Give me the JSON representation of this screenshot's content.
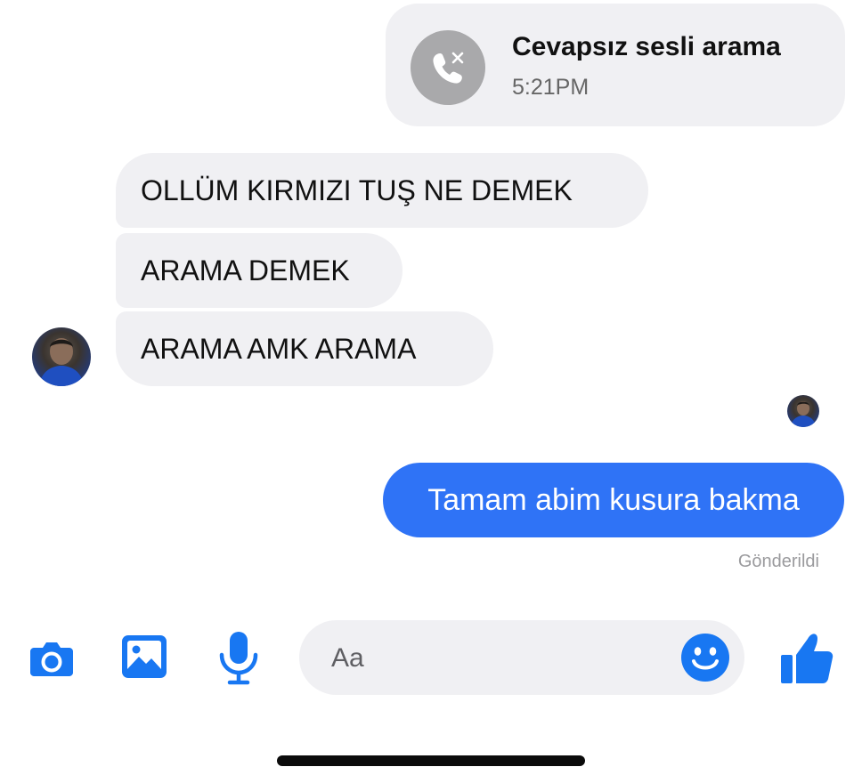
{
  "missed_call": {
    "title": "Cevapsız sesli arama",
    "time": "5:21PM"
  },
  "messages_in": [
    {
      "text": "OLLÜM KIRMIZI TUŞ NE DEMEK"
    },
    {
      "text": "ARAMA DEMEK"
    },
    {
      "text": "ARAMA AMK ARAMA"
    }
  ],
  "message_out": {
    "text": "Tamam abim kusura bakma",
    "status": "Gönderildi"
  },
  "composer": {
    "placeholder": "Aa"
  },
  "toolbar": {
    "icons": [
      "camera-icon",
      "image-icon",
      "microphone-icon",
      "emoji-icon",
      "thumbs-up-icon"
    ]
  },
  "colors": {
    "accent": "#2f73f6",
    "icon_blue": "#1877f2",
    "bubble_gray": "#f0f0f3",
    "missed_icon_gray": "#a9a9ab"
  }
}
